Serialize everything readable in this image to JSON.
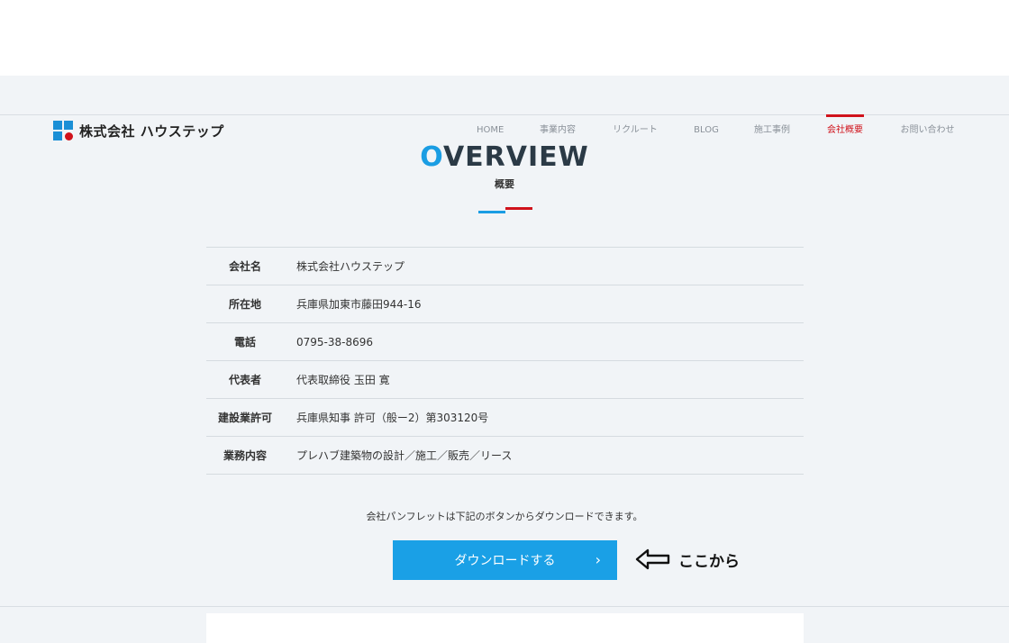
{
  "brand": {
    "name": "株式会社 ハウステップ",
    "colors": {
      "blue": "#1a8fd6",
      "red": "#d0121b",
      "button": "#1aa0e6"
    }
  },
  "nav": {
    "items": [
      {
        "label": "HOME",
        "active": false
      },
      {
        "label": "事業内容",
        "active": false
      },
      {
        "label": "リクルート",
        "active": false
      },
      {
        "label": "BLOG",
        "active": false
      },
      {
        "label": "施工事例",
        "active": false
      },
      {
        "label": "会社概要",
        "active": true
      },
      {
        "label": "お問い合わせ",
        "active": false
      }
    ]
  },
  "overview": {
    "title_first_letter": "O",
    "title_rest": "VERVIEW",
    "subtitle": "概要"
  },
  "company_info": [
    {
      "label": "会社名",
      "value": "株式会社ハウステップ"
    },
    {
      "label": "所在地",
      "value": "兵庫県加東市藤田944-16"
    },
    {
      "label": "電話",
      "value": "0795-38-8696"
    },
    {
      "label": "代表者",
      "value": "代表取締役 玉田 寛"
    },
    {
      "label": "建設業許可",
      "value": "兵庫県知事 許可（般ー2）第303120号"
    },
    {
      "label": "業務内容",
      "value": "プレハブ建築物の設計／施工／販売／リース"
    }
  ],
  "download": {
    "note": "会社パンフレットは下記のボタンからダウンロードできます。",
    "button_label": "ダウンロードする",
    "chevron": "›"
  },
  "annotation": {
    "icon": "left-arrow-icon",
    "text": "ここから"
  }
}
